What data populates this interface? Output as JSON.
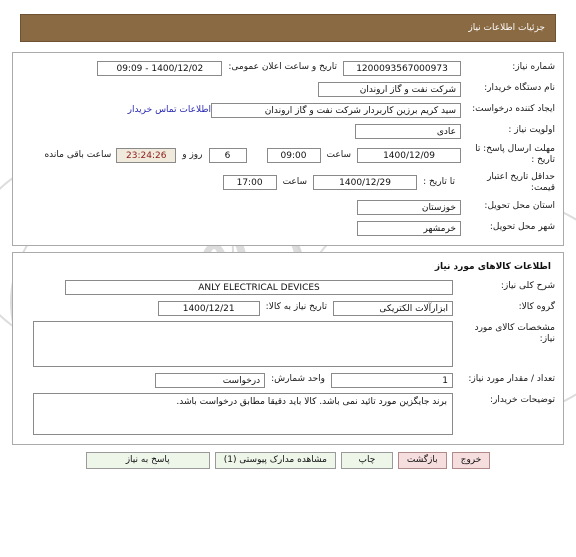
{
  "window": {
    "title": "جزئیات اطلاعات نیاز"
  },
  "watermarks": {
    "line1": "1001",
    "line2": "NamadData",
    "line3": "پایگاه اطلاع رسانی مناقصه و مزایده",
    "line4": "۱۱-۸۸۹۴۶۲۷",
    "line5": "۵۱۰۱",
    "script": "مرکز فن آوری اطلاعات پارس نماد داده ها"
  },
  "need_info": {
    "need_number": {
      "label": "شماره نیاز:",
      "value": "1200093567000973"
    },
    "public_announce": {
      "label": "تاریخ و ساعت اعلان عمومی:",
      "value": "1400/12/02 - 09:09"
    },
    "buyer_org": {
      "label": "نام دستگاه خریدار:",
      "value": "شرکت نفت و گاز اروندان"
    },
    "requester": {
      "label": "ایجاد کننده درخواست:",
      "value": "سید کریم برزین کاربردار شرکت نفت و گاز اروندان"
    },
    "contact_link": {
      "label": "اطلاعات تماس خریدار"
    },
    "priority": {
      "label": "اولویت نیاز :",
      "value": "عادی"
    },
    "reply_deadline": {
      "label": "مهلت ارسال پاسخ: تا تاریخ :",
      "date": "1400/12/09",
      "time_label": "ساعت",
      "time": "09:00",
      "days": "6",
      "days_sep": "روز و",
      "countdown": "23:24:26",
      "remaining_label": "ساعت باقی مانده"
    },
    "price_validity": {
      "label": "حداقل تاریخ اعتبار قیمت:",
      "until_label": "تا تاریخ :",
      "date": "1400/12/29",
      "time_label": "ساعت",
      "time": "17:00"
    },
    "delivery_province": {
      "label": "استان محل تحویل:",
      "value": "خوزستان"
    },
    "delivery_city": {
      "label": "شهر محل تحویل:",
      "value": "خرمشهر"
    }
  },
  "goods_info": {
    "section_title": "اطلاعات کالاهای مورد نیاز",
    "general_desc": {
      "label": "شرح کلی نیاز:",
      "value": "ANLY ELECTRICAL DEVICES"
    },
    "goods_group": {
      "label": "گروه کالا:",
      "value": "ابزارآلات الکتریکی"
    },
    "need_date": {
      "label": "تاریخ نیاز به کالا:",
      "value": "1400/12/21"
    },
    "specs": {
      "label": "مشخصات کالای مورد نیاز:",
      "value": ""
    },
    "quantity": {
      "label": "تعداد / مقدار مورد نیاز:",
      "value": "1"
    },
    "unit": {
      "label": "واحد شمارش:",
      "value": "درخواست"
    },
    "buyer_notes": {
      "label": "توضیحات خریدار:",
      "value": "برند جایگزین مورد تائید نمی باشد. کالا باید دقیقا مطابق درخواست باشد."
    }
  },
  "buttons": {
    "reply": "پاسخ به نیاز",
    "attachments": "مشاهده مدارک پیوستی (1)",
    "print": "چاپ",
    "back": "بازگشت",
    "exit": "خروج"
  },
  "colors": {
    "titlebar": "#8a6a43",
    "link": "#2b2bb5",
    "countdown_text": "#8d1a1a",
    "countdown_bg": "#efeadb",
    "btn_green": "#eef6ea",
    "btn_pink": "#f7dede"
  }
}
